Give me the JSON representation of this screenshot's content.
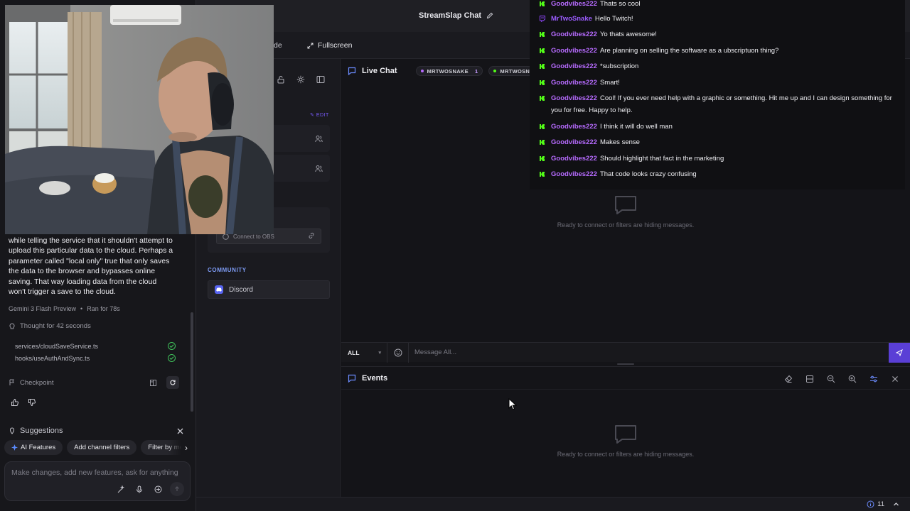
{
  "colors": {
    "accent": "#5a3fd6",
    "kick_green": "#53fc18",
    "twitch_purple": "#9146ff",
    "username": "#b76bff",
    "success": "#3fbf5a"
  },
  "assistant": {
    "message_lines": [
      "while telling the service that it shouldn't attempt to",
      "upload this particular data to the cloud. Perhaps a",
      "parameter called \"local only\" true that only saves",
      "the data to the browser and bypasses online",
      "saving. That way loading data from the cloud",
      "won't trigger a save to the cloud."
    ],
    "model": "Gemini 3 Flash Preview",
    "run_time": "Ran for 78s",
    "thought": "Thought for 42 seconds",
    "files": [
      "services/cloudSaveService.ts",
      "hooks/useAuthAndSync.ts"
    ],
    "checkpoint_label": "Checkpoint",
    "suggestions_title": "Suggestions",
    "chips": [
      "AI Features",
      "Add channel filters",
      "Filter by me"
    ],
    "prompt_placeholder": "Make changes, add new features, ask for anything"
  },
  "sidebar": {
    "edit_label": "EDIT",
    "obs_button": "Connect to OBS",
    "community_label": "COMMUNITY",
    "discord_label": "Discord"
  },
  "header": {
    "title": "StreamSlap Chat"
  },
  "toolbar": {
    "partial_label": "de",
    "fullscreen_label": "Fullscreen"
  },
  "live_chat": {
    "title": "Live Chat",
    "channels": [
      {
        "name": "MRTWOSNAKE",
        "count": "1",
        "dot": "#b76bff"
      },
      {
        "name": "MRTWOSNAKE",
        "count": "",
        "dot": "#53fc18"
      }
    ],
    "empty_text": "Ready to connect or filters are hiding messages."
  },
  "input": {
    "filter_value": "ALL",
    "placeholder": "Message All..."
  },
  "events": {
    "title": "Events",
    "empty_text": "Ready to connect or filters are hiding messages."
  },
  "overlay_messages": [
    {
      "platform": "kick",
      "user": "Goodvibes222",
      "text": "Thats so cool"
    },
    {
      "platform": "twitch",
      "user": "MrTwoSnake",
      "text": "Hello Twitch!"
    },
    {
      "platform": "kick",
      "user": "Goodvibes222",
      "text": "Yo thats awesome!"
    },
    {
      "platform": "kick",
      "user": "Goodvibes222",
      "text": "Are planning on selling the software as a ubscriptuon thing?"
    },
    {
      "platform": "kick",
      "user": "Goodvibes222",
      "text": "*subscription"
    },
    {
      "platform": "kick",
      "user": "Goodvibes222",
      "text": "Smart!"
    },
    {
      "platform": "kick",
      "user": "Goodvibes222",
      "text": "Cool! If you ever need help with a graphic or something. Hit me up and I can design something for you for free. Happy to help."
    },
    {
      "platform": "kick",
      "user": "Goodvibes222",
      "text": "I think it will do well man"
    },
    {
      "platform": "kick",
      "user": "Goodvibes222",
      "text": "Makes sense"
    },
    {
      "platform": "kick",
      "user": "Goodvibes222",
      "text": "Should highlight that fact in the marketing"
    },
    {
      "platform": "kick",
      "user": "Goodvibes222",
      "text": "That code looks crazy confusing"
    }
  ],
  "status": {
    "issues_count": "11"
  }
}
